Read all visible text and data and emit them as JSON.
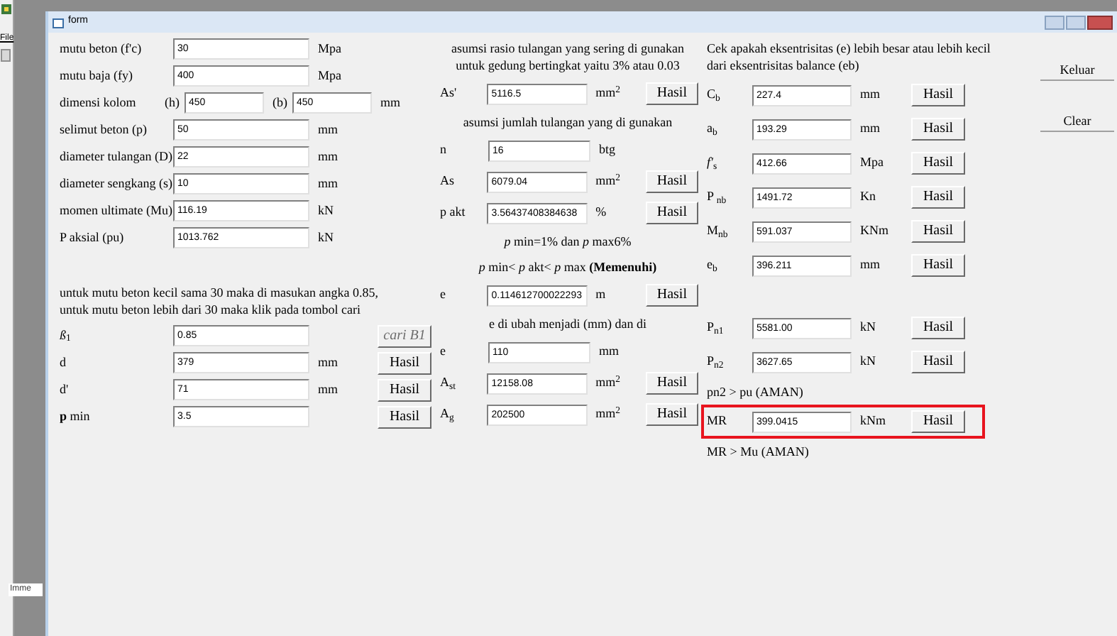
{
  "app": {
    "menu": [
      "File"
    ],
    "immediate_label": "Imme"
  },
  "window": {
    "title": "form"
  },
  "columns": [
    {
      "groups": [
        [
          {
            "kind": "field",
            "label": "mutu beton (f'c)",
            "value": "30",
            "unit": "Mpa"
          },
          {
            "kind": "field",
            "label": "mutu baja (fy)",
            "value": "400",
            "unit": "Mpa"
          },
          {
            "kind": "dual",
            "label": "dimensi kolom",
            "inputs": [
              {
                "prefix": "(h)",
                "value": "450"
              },
              {
                "prefix": "(b)",
                "value": "450"
              }
            ],
            "unit": "mm"
          },
          {
            "kind": "field",
            "label": "selimut beton  (p)",
            "value": "50",
            "unit": "mm"
          },
          {
            "kind": "field",
            "label": "diameter tulangan (D)",
            "value": "22",
            "unit": "mm"
          },
          {
            "kind": "field",
            "label": "diameter sengkang (s)",
            "value": "10",
            "unit": "mm"
          },
          {
            "kind": "field",
            "label": "momen ultimate (Mu)",
            "value": "116.19",
            "unit": "kN"
          },
          {
            "kind": "field",
            "label": "P aksial (pu)",
            "value": "1013.762",
            "unit": "kN"
          }
        ],
        [
          {
            "kind": "note",
            "text": "untuk mutu beton kecil sama 30 maka di masukan angka 0.85, untuk mutu beton lebih dari 30 maka klik pada tombol cari"
          },
          {
            "kind": "field",
            "label": "*ß*$_{1}$",
            "value": "0.85",
            "button": {
              "label": "cari B1",
              "disabled": true
            }
          },
          {
            "kind": "field",
            "label": "d",
            "value": "379",
            "unit": "mm",
            "button": {
              "label": "Hasil",
              "disabled": false
            }
          },
          {
            "kind": "field",
            "label": "d'",
            "value": "71",
            "unit": "mm",
            "button": {
              "label": "Hasil",
              "disabled": false
            }
          },
          {
            "kind": "field",
            "label": "**p** min",
            "value": "3.5",
            "button": {
              "label": "Hasil",
              "disabled": false
            }
          }
        ]
      ]
    },
    {
      "groups": [
        [
          {
            "kind": "note",
            "text": "asumsi rasio tulangan yang sering di gunakan untuk gedung bertingkat yaitu 3% atau 0.03"
          },
          {
            "kind": "field",
            "label": "As'",
            "value": "5116.5",
            "unit": "mm$^{2}$",
            "button": {
              "label": "Hasil",
              "disabled": false
            }
          },
          {
            "kind": "note",
            "text": "asumsi jumlah tulangan yang di gunakan"
          },
          {
            "kind": "field",
            "label": "n",
            "value": "16",
            "unit": "btg"
          },
          {
            "kind": "field",
            "label": "As",
            "value": "6079.04",
            "unit": "mm$^{2}$",
            "button": {
              "label": "Hasil",
              "disabled": false
            }
          },
          {
            "kind": "field",
            "label": "p akt",
            "value": "3.56437408384638",
            "unit": "%",
            "button": {
              "label": "Hasil",
              "disabled": false
            }
          },
          {
            "kind": "note",
            "text": "*p* min=1% dan *p* max6%"
          },
          {
            "kind": "note",
            "text": "*p* min< *p* akt< *p* max  **(Memenuhi)**"
          },
          {
            "kind": "field",
            "label": "e",
            "value": "0.114612700022293",
            "unit": "m",
            "button": {
              "label": "Hasil",
              "disabled": false
            }
          },
          {
            "kind": "note",
            "text": "e di ubah menjadi (mm) dan di"
          },
          {
            "kind": "field",
            "label": "e",
            "value": "110",
            "unit": "mm"
          },
          {
            "kind": "field",
            "label": "A$_{st}$",
            "value": "12158.08",
            "unit": "mm$^{2}$",
            "button": {
              "label": "Hasil",
              "disabled": false
            }
          },
          {
            "kind": "field",
            "label": "A$_{g}$",
            "value": "202500",
            "unit": "mm$^{2}$",
            "button": {
              "label": "Hasil",
              "disabled": false
            }
          }
        ]
      ]
    },
    {
      "groups": [
        [
          {
            "kind": "note",
            "text": "Cek apakah eksentrisitas (e) lebih besar atau lebih kecil dari eksentrisitas balance (eb)"
          },
          {
            "kind": "field",
            "label": "C$_{b}$",
            "value": "227.4",
            "unit": "mm",
            "button": {
              "label": "Hasil",
              "disabled": false
            }
          },
          {
            "kind": "field",
            "label": "a$_{b}$",
            "value": "193.29",
            "unit": "mm",
            "button": {
              "label": "Hasil",
              "disabled": false
            }
          },
          {
            "kind": "field",
            "label": "*f'*$_{s}$",
            "value": "412.66",
            "unit": "Mpa",
            "button": {
              "label": "Hasil",
              "disabled": false
            }
          },
          {
            "kind": "field",
            "label": "P $_{nb}$",
            "value": "1491.72",
            "unit": "Kn",
            "button": {
              "label": "Hasil",
              "disabled": false
            }
          },
          {
            "kind": "field",
            "label": "M$_{nb}$",
            "value": "591.037",
            "unit": "KNm",
            "button": {
              "label": "Hasil",
              "disabled": false
            }
          },
          {
            "kind": "field",
            "label": "e$_{b}$",
            "value": "396.211",
            "unit": "mm",
            "button": {
              "label": "Hasil",
              "disabled": false
            }
          }
        ],
        [
          {
            "kind": "field",
            "label": "P$_{n1}$",
            "value": "5581.00",
            "unit": "kN",
            "button": {
              "label": "Hasil",
              "disabled": false
            }
          },
          {
            "kind": "field",
            "label": "P$_{n2}$",
            "value": "3627.65",
            "unit": "kN",
            "button": {
              "label": "Hasil",
              "disabled": false
            }
          },
          {
            "kind": "note",
            "text": "pn2  > pu  (AMAN)"
          },
          {
            "kind": "field",
            "label": "MR",
            "value": "399.0415",
            "unit": "kNm",
            "highlighted": true,
            "button": {
              "label": "Hasil",
              "disabled": false
            }
          },
          {
            "kind": "note",
            "text": "MR  >  Mu  (AMAN)"
          }
        ]
      ]
    }
  ],
  "side_buttons": [
    "Keluar",
    "Clear"
  ]
}
